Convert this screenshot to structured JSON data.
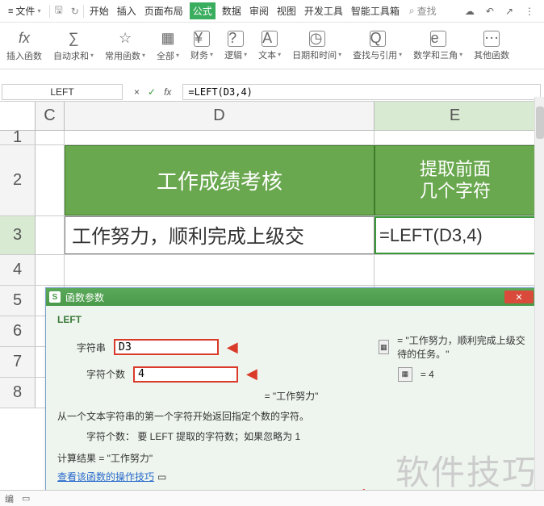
{
  "topbar": {
    "file_menu": "文件",
    "tabs": [
      "开始",
      "插入",
      "页面布局",
      "公式",
      "数据",
      "审阅",
      "视图",
      "开发工具",
      "智能工具箱"
    ],
    "active_tab_index": 3,
    "search_placeholder": "查找"
  },
  "ribbon": {
    "items": [
      {
        "icon": "fx",
        "label": "插入函数"
      },
      {
        "icon": "Σ",
        "label": "自动求和"
      },
      {
        "icon": "☆",
        "label": "常用函数"
      },
      {
        "icon": "▦",
        "label": "全部"
      },
      {
        "icon": "¥",
        "label": "财务"
      },
      {
        "icon": "?",
        "label": "逻辑"
      },
      {
        "icon": "A",
        "label": "文本"
      },
      {
        "icon": "◷",
        "label": "日期和时间"
      },
      {
        "icon": "Q",
        "label": "查找与引用"
      },
      {
        "icon": "e",
        "label": "数学和三角"
      },
      {
        "icon": "⋯",
        "label": "其他函数"
      }
    ]
  },
  "formula_bar": {
    "name_box": "LEFT",
    "cancel": "×",
    "confirm": "✓",
    "fx": "fx",
    "formula": "=LEFT(D3,4)"
  },
  "columns": {
    "c": "C",
    "d": "D",
    "e": "E"
  },
  "rows": {
    "r1": "1",
    "r2": "2",
    "r3": "3",
    "r4": "4",
    "r5": "5",
    "r6": "6",
    "r7": "7",
    "r8": "8"
  },
  "cells": {
    "d2": "工作成绩考核",
    "e2": "提取前面\n几个字符",
    "d3": "工作努力，顺利完成上级交",
    "e3": "=LEFT(D3,4)"
  },
  "dialog": {
    "title": "函数参数",
    "func": "LEFT",
    "param1_label": "字符串",
    "param1_value": "D3",
    "param1_result": "= \"工作努力，顺利完成上级交待的任务。\"",
    "param2_label": "字符个数",
    "param2_value": "4",
    "param2_result": "= 4",
    "preview": "= \"工作努力\"",
    "desc": "从一个文本字符串的第一个字符开始返回指定个数的字符。",
    "desc_sub": "字符个数： 要 LEFT 提取的字符数；如果忽略为 1",
    "calc_label": "计算结果 = \"工作努力\"",
    "link": "查看该函数的操作技巧"
  },
  "watermark": "软件技巧",
  "status": {
    "left": "编"
  }
}
